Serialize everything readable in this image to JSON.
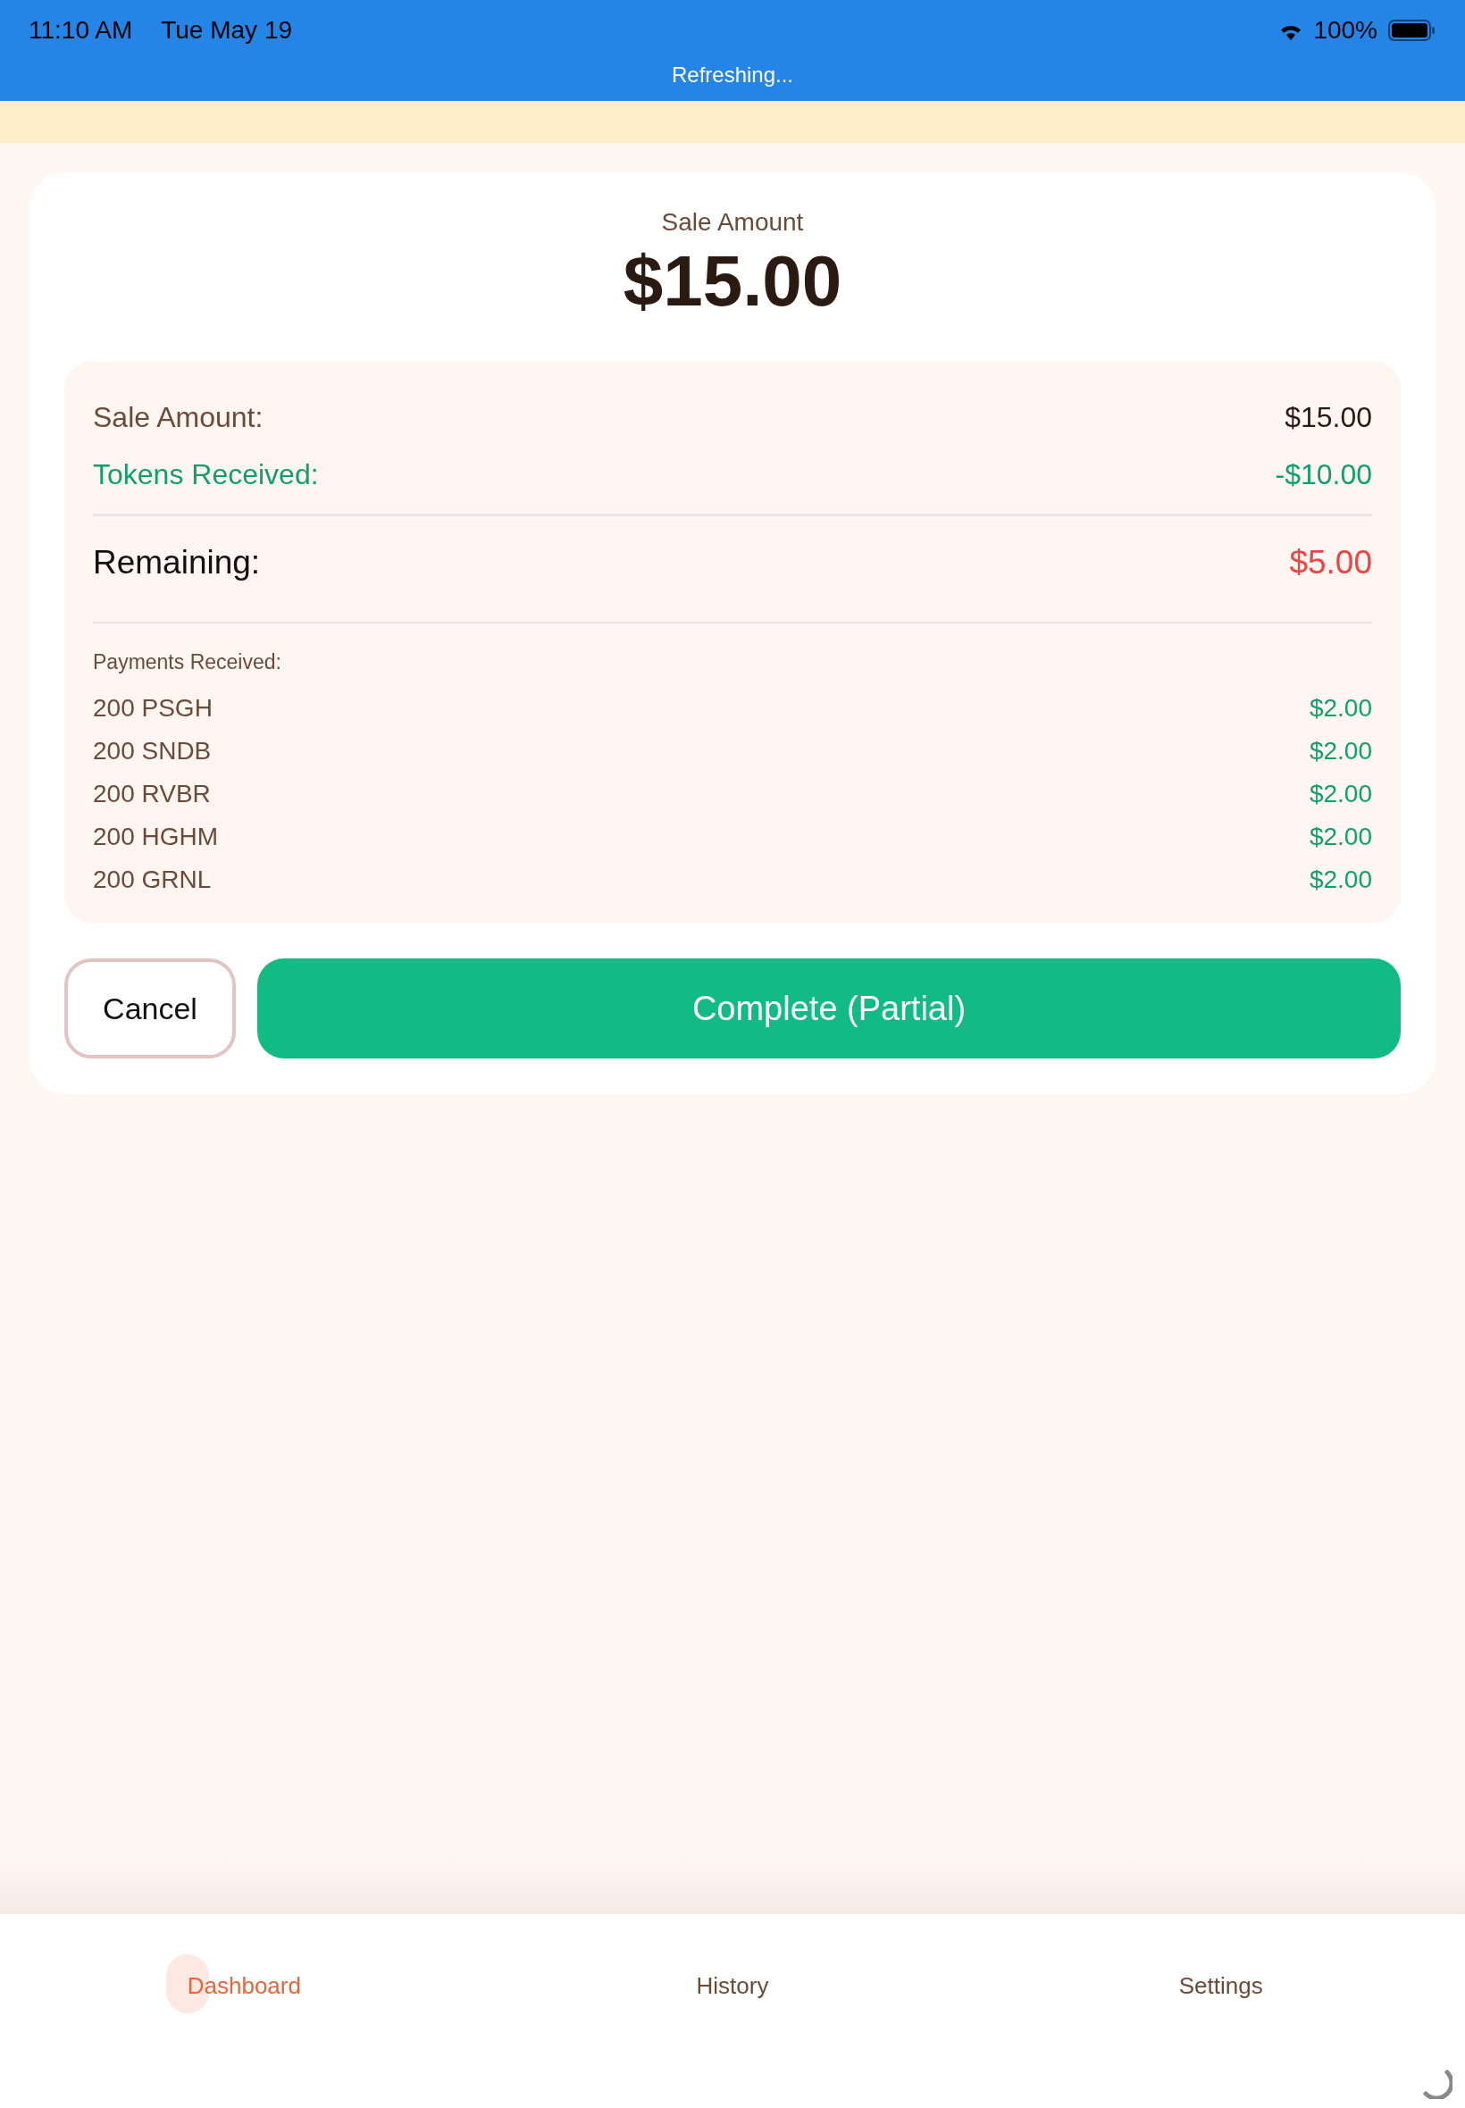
{
  "status_bar": {
    "time": "11:10 AM",
    "date": "Tue May 19",
    "battery": "100%",
    "banner": "Refreshing..."
  },
  "summary": {
    "label": "Sale Amount",
    "amount": "$15.00"
  },
  "breakdown": {
    "rows": [
      {
        "kind": "normal",
        "label": "Sale Amount:",
        "value": "$15.00"
      },
      {
        "kind": "credit",
        "label": "Tokens Received:",
        "value": "-$10.00"
      },
      {
        "kind": "total",
        "label": "Remaining:",
        "value": "$5.00"
      }
    ],
    "payments_title": "Payments Received:",
    "payments": [
      {
        "name": "200 PSGH",
        "amount": "$2.00"
      },
      {
        "name": "200 SNDB",
        "amount": "$2.00"
      },
      {
        "name": "200 RVBR",
        "amount": "$2.00"
      },
      {
        "name": "200 HGHM",
        "amount": "$2.00"
      },
      {
        "name": "200 GRNL",
        "amount": "$2.00"
      }
    ]
  },
  "buttons": {
    "cancel": "Cancel",
    "complete": "Complete (Partial)"
  },
  "tab_bar": [
    {
      "label": "Dashboard",
      "selected": true
    },
    {
      "label": "History",
      "selected": false
    },
    {
      "label": "Settings",
      "selected": false
    }
  ]
}
